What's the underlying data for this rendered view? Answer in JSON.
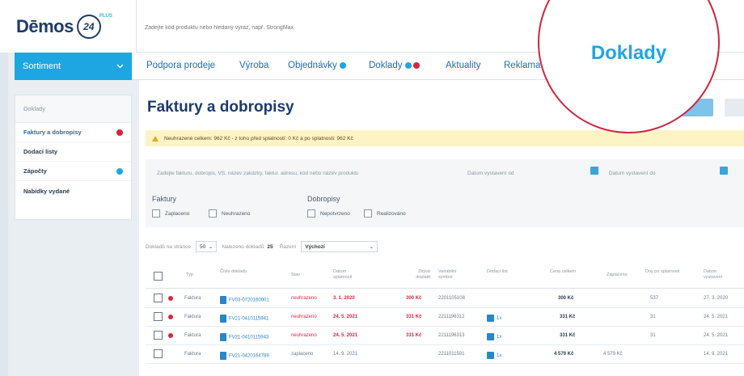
{
  "brand": {
    "name": "Dēmos",
    "badge": "24",
    "plus": "PLUS"
  },
  "search": {
    "placeholder": "Zadejte kód produktu nebo hledaný výraz, např. StrongMax"
  },
  "sortiment": {
    "label": "Sortiment"
  },
  "nav": {
    "items": [
      {
        "label": "Podpora prodeje"
      },
      {
        "label": "Výroba"
      },
      {
        "label": "Objednávky"
      },
      {
        "label": "Doklady"
      },
      {
        "label": "Aktuality"
      },
      {
        "label": "Reklama"
      }
    ]
  },
  "sidebar": {
    "heading": "Doklady",
    "items": [
      {
        "label": "Faktury a dobropisy"
      },
      {
        "label": "Dodací listy"
      },
      {
        "label": "Zápočty"
      },
      {
        "label": "Nabídky vydané"
      }
    ]
  },
  "page": {
    "title": "Faktury a dobropisy",
    "alert": "Neuhrazené celkem: 962 Kč - z toho před splatností: 0 Kč a po splatnosti: 962 Kč"
  },
  "filters": {
    "search_placeholder": "Zadejte fakturu, dobropis, VS, název zakázky, faktur. adresu, kód nebo název produktu",
    "date_from": "Datum vystavení od",
    "date_to": "Datum vystavení do",
    "faktury_label": "Faktury",
    "dobropisy_label": "Dobropisy",
    "zaplaceno": "Zaplaceno",
    "neuhrazeno": "Neuhrazeno",
    "nepotvrzeno": "Nepotvrzeno",
    "realizovano": "Realizováno"
  },
  "pager": {
    "per_page_label": "Dokladů na stránce",
    "per_page_value": "50",
    "found_label": "Nalezeno dokladů",
    "found_value": "25",
    "sort_label": "Řazení",
    "sort_value": "Výchozí"
  },
  "table": {
    "headers": {
      "typ": "Typ",
      "cislo": "Číslo dokladu",
      "stav": "Stav",
      "splatnost": "Datum splatnosti",
      "zbyva": "Zbývá doplatit",
      "vs": "Variabilní symbol",
      "dodaci": "Dodací list",
      "cena": "Cena celkem",
      "zaplaceno": "Zaplaceno",
      "dny": "Dny po splatnosti",
      "vystaveni": "Datum vystavení"
    },
    "rows": [
      {
        "typ": "Faktura",
        "cislo": "FV03-0720160001",
        "stav": "neuhrazeno",
        "splatnost": "3. 1. 2020",
        "zbyva": "300 Kč",
        "vs": "2201105108",
        "dodaci": "",
        "cena": "300 Kč",
        "zaplaceno": "",
        "dny": "537",
        "vystaveni": "27. 3. 2020"
      },
      {
        "typ": "Faktura",
        "cislo": "FV21-0410115941",
        "stav": "neuhrazeno",
        "splatnost": "24. 5. 2021",
        "zbyva": "331 Kč",
        "vs": "2211196312",
        "dodaci": "1x",
        "cena": "331 Kč",
        "zaplaceno": "",
        "dny": "31",
        "vystaveni": "24. 5. 2021"
      },
      {
        "typ": "Faktura",
        "cislo": "FV21-0410115943",
        "stav": "neuhrazeno",
        "splatnost": "24. 5. 2021",
        "zbyva": "331 Kč",
        "vs": "2211196313",
        "dodaci": "1x",
        "cena": "331 Kč",
        "zaplaceno": "",
        "dny": "31",
        "vystaveni": "24. 5. 2021"
      },
      {
        "typ": "Faktura",
        "cislo": "FV21-0420164789",
        "stav": "zaplaceno",
        "splatnost": "14. 9. 2021",
        "zbyva": "",
        "vs": "2211011501",
        "dodaci": "1x",
        "cena": "4 579 Kč",
        "zaplaceno": "4 579 Kč",
        "dny": "",
        "vystaveni": "14. 9. 2021"
      }
    ]
  },
  "callout": {
    "label": "Doklady"
  }
}
